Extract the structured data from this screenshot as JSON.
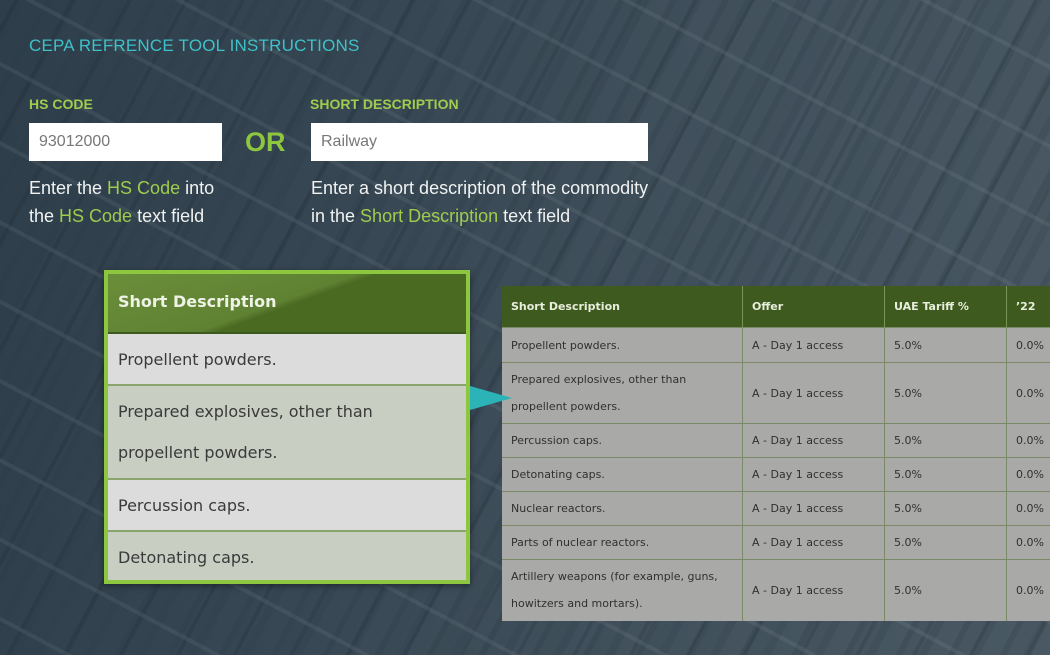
{
  "title": "CEPA REFRENCE TOOL INSTRUCTIONS",
  "hs_code": {
    "label": "HS CODE",
    "value": "93012000",
    "hint_pre": "Enter the ",
    "hint_link": "HS Code",
    "hint_mid": " into",
    "hint_pre2": "the ",
    "hint_link2": "HS Code",
    "hint_post2": " text field"
  },
  "or_text": "OR",
  "short_desc": {
    "label": "SHORT DESCRIPTION",
    "value": "Railway",
    "hint_line1": "Enter a short description of the commodity",
    "hint_pre2": "in the ",
    "hint_link2": "Short Description",
    "hint_post2": " text field"
  },
  "callout": {
    "header": "Short Description",
    "rows": [
      "Propellent powders.",
      "Prepared explosives, other than propellent powders.",
      "Percussion caps.",
      "Detonating caps."
    ]
  },
  "table": {
    "headers": [
      "Short Description",
      "Offer",
      "UAE Tariff %",
      "’22"
    ],
    "rows": [
      {
        "desc": "Propellent powders.",
        "offer": "A - Day 1 access",
        "tariff": "5.0%",
        "y22": "0.0%"
      },
      {
        "desc": "Prepared explosives, other than propellent powders.",
        "offer": "A - Day 1 access",
        "tariff": "5.0%",
        "y22": "0.0%"
      },
      {
        "desc": "Percussion caps.",
        "offer": "A - Day 1 access",
        "tariff": "5.0%",
        "y22": "0.0%"
      },
      {
        "desc": "Detonating caps.",
        "offer": "A - Day 1 access",
        "tariff": "5.0%",
        "y22": "0.0%"
      },
      {
        "desc": "Nuclear reactors.",
        "offer": "A - Day 1 access",
        "tariff": "5.0%",
        "y22": "0.0%"
      },
      {
        "desc": "Parts of nuclear reactors.",
        "offer": "A - Day 1 access",
        "tariff": "5.0%",
        "y22": "0.0%"
      },
      {
        "desc": "Artillery weapons (for example, guns, howitzers and mortars).",
        "offer": "A - Day 1 access",
        "tariff": "5.0%",
        "y22": "0.0%"
      }
    ]
  },
  "colors": {
    "accent_teal": "#3fc1c9",
    "accent_green": "#9fcc4e",
    "table_header": "#3f5a1f",
    "callout_border": "#8dc63f"
  }
}
